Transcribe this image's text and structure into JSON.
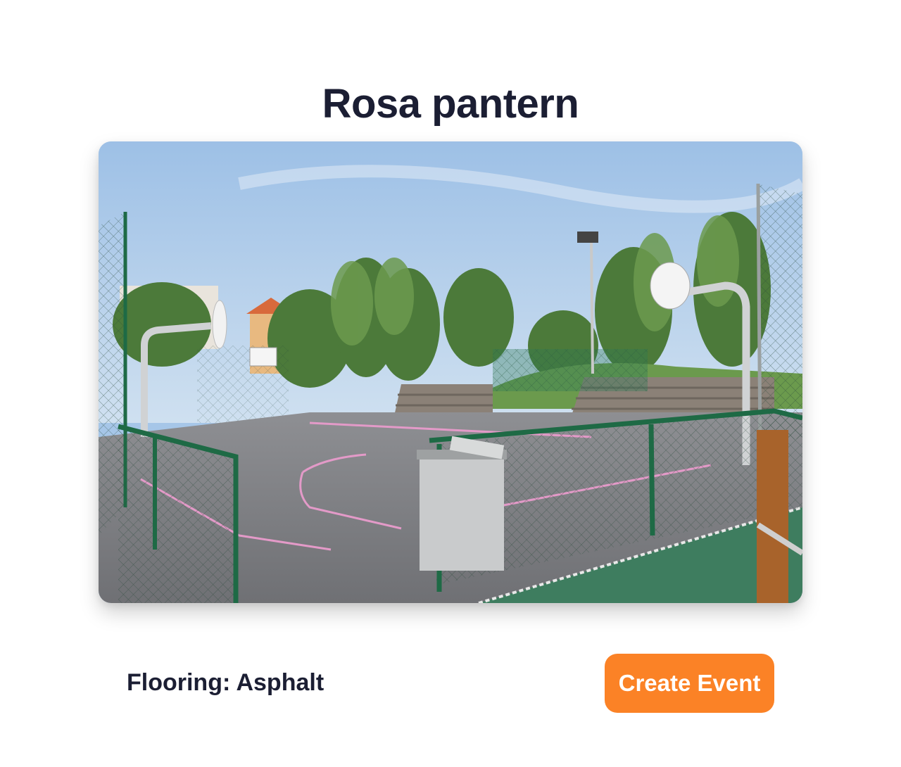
{
  "court": {
    "name": "Rosa pantern",
    "flooring_label": "Flooring: Asphalt"
  },
  "actions": {
    "create_event_label": "Create Event"
  },
  "colors": {
    "title_text": "#1b1e33",
    "button_background": "#fb8226",
    "button_text": "#ffffff"
  },
  "image": {
    "semantic": "outdoor-basketball-court-photo"
  }
}
